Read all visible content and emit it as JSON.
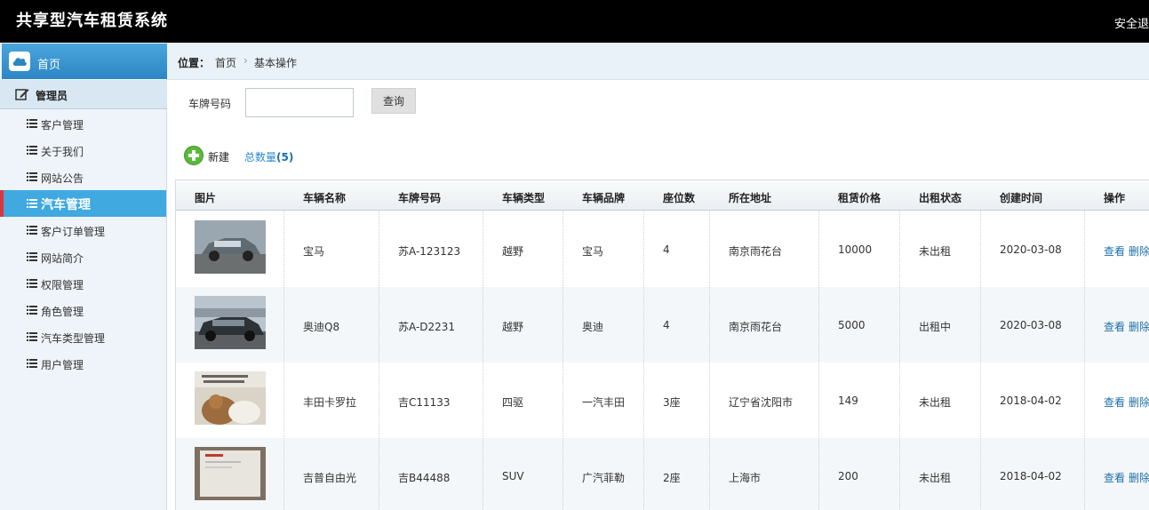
{
  "header": {
    "app_title": "共享型汽车租赁系统",
    "logout_label": "安全退"
  },
  "sidebar": {
    "home_label": "首页",
    "admin_label": "管理员",
    "items": [
      {
        "label": "客户管理"
      },
      {
        "label": "关于我们"
      },
      {
        "label": "网站公告"
      },
      {
        "label": "汽车管理",
        "active": true
      },
      {
        "label": "客户订单管理"
      },
      {
        "label": "网站简介"
      },
      {
        "label": "权限管理"
      },
      {
        "label": "角色管理"
      },
      {
        "label": "汽车类型管理"
      },
      {
        "label": "用户管理"
      }
    ]
  },
  "breadcrumb": {
    "label": "位置：",
    "home": "首页",
    "separator": "›",
    "current": "基本操作"
  },
  "filter": {
    "plate_label": "车牌号码",
    "plate_value": "",
    "query_label": "查询"
  },
  "toolbar": {
    "new_label": "新建",
    "total_label": "总数量",
    "total_open": "(",
    "total_count": "5",
    "total_close": ")"
  },
  "table": {
    "columns": [
      "图片",
      "车辆名称",
      "车牌号码",
      "车辆类型",
      "车辆品牌",
      "座位数",
      "所在地址",
      "租赁价格",
      "出租状态",
      "创建时间",
      "操作"
    ],
    "view_label": "查看",
    "delete_label": "删除",
    "rows": [
      {
        "name": "宝马",
        "plate": "苏A-123123",
        "type": "越野",
        "brand": "宝马",
        "seats": "4",
        "address": "南京雨花台",
        "price": "10000",
        "status": "未出租",
        "created": "2020-03-08"
      },
      {
        "name": "奥迪Q8",
        "plate": "苏A-D2231",
        "type": "越野",
        "brand": "奥迪",
        "seats": "4",
        "address": "南京雨花台",
        "price": "5000",
        "status": "出租中",
        "created": "2020-03-08"
      },
      {
        "name": "丰田卡罗拉",
        "plate": "吉C11133",
        "type": "四驱",
        "brand": "一汽丰田",
        "seats": "3座",
        "address": "辽宁省沈阳市",
        "price": "149",
        "status": "未出租",
        "created": "2018-04-02"
      },
      {
        "name": "吉普自由光",
        "plate": "吉B44488",
        "type": "SUV",
        "brand": "广汽菲勒",
        "seats": "2座",
        "address": "上海市",
        "price": "200",
        "status": "未出租",
        "created": "2018-04-02"
      }
    ]
  },
  "colors": {
    "topbar": "#000000",
    "sidebar_active": "#3fa9e0",
    "link": "#1e6fa8"
  }
}
